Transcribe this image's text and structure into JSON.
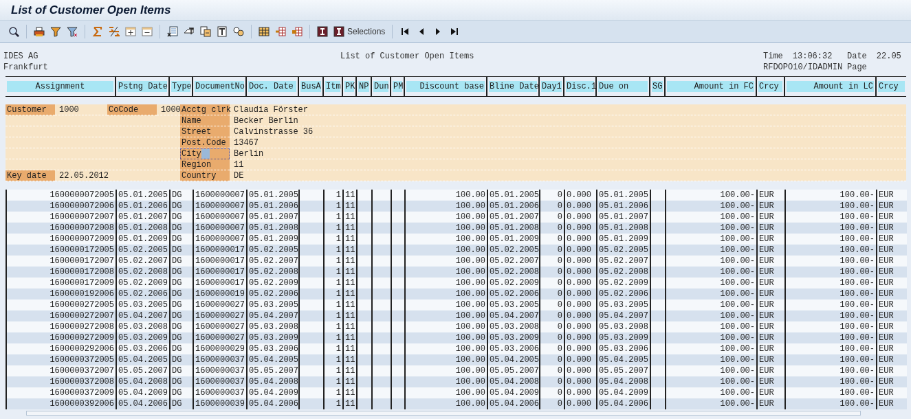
{
  "window": {
    "title": "List of Customer Open Items"
  },
  "toolbar": {
    "selections_label": "Selections"
  },
  "header": {
    "company": "IDES AG",
    "city": "Frankfurt",
    "report_title": "List of Customer Open Items",
    "time_label": "Time",
    "time": "13:06:32",
    "date_label": "Date",
    "date": "22.05",
    "program": "RFDOPO10/IDADMIN",
    "page_label": "Page"
  },
  "table": {
    "columns": [
      "Assignment",
      "Pstng Date",
      "Type",
      "DocumentNo",
      "Doc. Date",
      "BusA",
      "Itm",
      "PK",
      "NP",
      "Dun",
      "PM",
      "Discount base",
      "Bline Date",
      "Day1",
      "Disc.1",
      "Due on",
      "SG",
      "Amount in FC",
      "Crcy",
      "Amount in LC",
      "Crcy"
    ],
    "customer_block": {
      "customer_label": "Customer",
      "customer": "1000",
      "cocode_label": "CoCode",
      "cocode": "1000",
      "key_date_label": "Key date",
      "key_date": "22.05.2012",
      "details": [
        {
          "label": "Acctg clrk",
          "value": "Claudia Förster",
          "cursor": false
        },
        {
          "label": "Name",
          "value": "Becker Berlin",
          "cursor": false
        },
        {
          "label": "Street",
          "value": "Calvinstrasse 36",
          "cursor": false
        },
        {
          "label": "Post.Code",
          "value": "13467",
          "cursor": false
        },
        {
          "label": "City",
          "value": "Berlin",
          "cursor": true
        },
        {
          "label": "Region",
          "value": "11",
          "cursor": false
        },
        {
          "label": "Country",
          "value": "DE",
          "cursor": false
        }
      ]
    },
    "rows": [
      {
        "assignment": "1600000072005",
        "pstng_date": "05.01.2005",
        "type": "DG",
        "document_no": "1600000007",
        "doc_date": "05.01.2005",
        "itm": "1",
        "pk": "11",
        "discount_base": "100.00",
        "bline_date": "05.01.2005",
        "day1": "0",
        "disc_1": "0.000",
        "due_on": "05.01.2005",
        "amount_fc": "100.00-",
        "crcy_fc": "EUR",
        "amount_lc": "100.00-",
        "crcy_lc": "EUR"
      },
      {
        "assignment": "1600000072006",
        "pstng_date": "05.01.2006",
        "type": "DG",
        "document_no": "1600000007",
        "doc_date": "05.01.2006",
        "itm": "1",
        "pk": "11",
        "discount_base": "100.00",
        "bline_date": "05.01.2006",
        "day1": "0",
        "disc_1": "0.000",
        "due_on": "05.01.2006",
        "amount_fc": "100.00-",
        "crcy_fc": "EUR",
        "amount_lc": "100.00-",
        "crcy_lc": "EUR"
      },
      {
        "assignment": "1600000072007",
        "pstng_date": "05.01.2007",
        "type": "DG",
        "document_no": "1600000007",
        "doc_date": "05.01.2007",
        "itm": "1",
        "pk": "11",
        "discount_base": "100.00",
        "bline_date": "05.01.2007",
        "day1": "0",
        "disc_1": "0.000",
        "due_on": "05.01.2007",
        "amount_fc": "100.00-",
        "crcy_fc": "EUR",
        "amount_lc": "100.00-",
        "crcy_lc": "EUR"
      },
      {
        "assignment": "1600000072008",
        "pstng_date": "05.01.2008",
        "type": "DG",
        "document_no": "1600000007",
        "doc_date": "05.01.2008",
        "itm": "1",
        "pk": "11",
        "discount_base": "100.00",
        "bline_date": "05.01.2008",
        "day1": "0",
        "disc_1": "0.000",
        "due_on": "05.01.2008",
        "amount_fc": "100.00-",
        "crcy_fc": "EUR",
        "amount_lc": "100.00-",
        "crcy_lc": "EUR"
      },
      {
        "assignment": "1600000072009",
        "pstng_date": "05.01.2009",
        "type": "DG",
        "document_no": "1600000007",
        "doc_date": "05.01.2009",
        "itm": "1",
        "pk": "11",
        "discount_base": "100.00",
        "bline_date": "05.01.2009",
        "day1": "0",
        "disc_1": "0.000",
        "due_on": "05.01.2009",
        "amount_fc": "100.00-",
        "crcy_fc": "EUR",
        "amount_lc": "100.00-",
        "crcy_lc": "EUR"
      },
      {
        "assignment": "1600000172005",
        "pstng_date": "05.02.2005",
        "type": "DG",
        "document_no": "1600000017",
        "doc_date": "05.02.2005",
        "itm": "1",
        "pk": "11",
        "discount_base": "100.00",
        "bline_date": "05.02.2005",
        "day1": "0",
        "disc_1": "0.000",
        "due_on": "05.02.2005",
        "amount_fc": "100.00-",
        "crcy_fc": "EUR",
        "amount_lc": "100.00-",
        "crcy_lc": "EUR"
      },
      {
        "assignment": "1600000172007",
        "pstng_date": "05.02.2007",
        "type": "DG",
        "document_no": "1600000017",
        "doc_date": "05.02.2007",
        "itm": "1",
        "pk": "11",
        "discount_base": "100.00",
        "bline_date": "05.02.2007",
        "day1": "0",
        "disc_1": "0.000",
        "due_on": "05.02.2007",
        "amount_fc": "100.00-",
        "crcy_fc": "EUR",
        "amount_lc": "100.00-",
        "crcy_lc": "EUR"
      },
      {
        "assignment": "1600000172008",
        "pstng_date": "05.02.2008",
        "type": "DG",
        "document_no": "1600000017",
        "doc_date": "05.02.2008",
        "itm": "1",
        "pk": "11",
        "discount_base": "100.00",
        "bline_date": "05.02.2008",
        "day1": "0",
        "disc_1": "0.000",
        "due_on": "05.02.2008",
        "amount_fc": "100.00-",
        "crcy_fc": "EUR",
        "amount_lc": "100.00-",
        "crcy_lc": "EUR"
      },
      {
        "assignment": "1600000172009",
        "pstng_date": "05.02.2009",
        "type": "DG",
        "document_no": "1600000017",
        "doc_date": "05.02.2009",
        "itm": "1",
        "pk": "11",
        "discount_base": "100.00",
        "bline_date": "05.02.2009",
        "day1": "0",
        "disc_1": "0.000",
        "due_on": "05.02.2009",
        "amount_fc": "100.00-",
        "crcy_fc": "EUR",
        "amount_lc": "100.00-",
        "crcy_lc": "EUR"
      },
      {
        "assignment": "1600000192006",
        "pstng_date": "05.02.2006",
        "type": "DG",
        "document_no": "1600000019",
        "doc_date": "05.02.2006",
        "itm": "1",
        "pk": "11",
        "discount_base": "100.00",
        "bline_date": "05.02.2006",
        "day1": "0",
        "disc_1": "0.000",
        "due_on": "05.02.2006",
        "amount_fc": "100.00-",
        "crcy_fc": "EUR",
        "amount_lc": "100.00-",
        "crcy_lc": "EUR"
      },
      {
        "assignment": "1600000272005",
        "pstng_date": "05.03.2005",
        "type": "DG",
        "document_no": "1600000027",
        "doc_date": "05.03.2005",
        "itm": "1",
        "pk": "11",
        "discount_base": "100.00",
        "bline_date": "05.03.2005",
        "day1": "0",
        "disc_1": "0.000",
        "due_on": "05.03.2005",
        "amount_fc": "100.00-",
        "crcy_fc": "EUR",
        "amount_lc": "100.00-",
        "crcy_lc": "EUR"
      },
      {
        "assignment": "1600000272007",
        "pstng_date": "05.04.2007",
        "type": "DG",
        "document_no": "1600000027",
        "doc_date": "05.04.2007",
        "itm": "1",
        "pk": "11",
        "discount_base": "100.00",
        "bline_date": "05.04.2007",
        "day1": "0",
        "disc_1": "0.000",
        "due_on": "05.04.2007",
        "amount_fc": "100.00-",
        "crcy_fc": "EUR",
        "amount_lc": "100.00-",
        "crcy_lc": "EUR"
      },
      {
        "assignment": "1600000272008",
        "pstng_date": "05.03.2008",
        "type": "DG",
        "document_no": "1600000027",
        "doc_date": "05.03.2008",
        "itm": "1",
        "pk": "11",
        "discount_base": "100.00",
        "bline_date": "05.03.2008",
        "day1": "0",
        "disc_1": "0.000",
        "due_on": "05.03.2008",
        "amount_fc": "100.00-",
        "crcy_fc": "EUR",
        "amount_lc": "100.00-",
        "crcy_lc": "EUR"
      },
      {
        "assignment": "1600000272009",
        "pstng_date": "05.03.2009",
        "type": "DG",
        "document_no": "1600000027",
        "doc_date": "05.03.2009",
        "itm": "1",
        "pk": "11",
        "discount_base": "100.00",
        "bline_date": "05.03.2009",
        "day1": "0",
        "disc_1": "0.000",
        "due_on": "05.03.2009",
        "amount_fc": "100.00-",
        "crcy_fc": "EUR",
        "amount_lc": "100.00-",
        "crcy_lc": "EUR"
      },
      {
        "assignment": "1600000292006",
        "pstng_date": "05.03.2006",
        "type": "DG",
        "document_no": "1600000029",
        "doc_date": "05.03.2006",
        "itm": "1",
        "pk": "11",
        "discount_base": "100.00",
        "bline_date": "05.03.2006",
        "day1": "0",
        "disc_1": "0.000",
        "due_on": "05.03.2006",
        "amount_fc": "100.00-",
        "crcy_fc": "EUR",
        "amount_lc": "100.00-",
        "crcy_lc": "EUR"
      },
      {
        "assignment": "1600000372005",
        "pstng_date": "05.04.2005",
        "type": "DG",
        "document_no": "1600000037",
        "doc_date": "05.04.2005",
        "itm": "1",
        "pk": "11",
        "discount_base": "100.00",
        "bline_date": "05.04.2005",
        "day1": "0",
        "disc_1": "0.000",
        "due_on": "05.04.2005",
        "amount_fc": "100.00-",
        "crcy_fc": "EUR",
        "amount_lc": "100.00-",
        "crcy_lc": "EUR"
      },
      {
        "assignment": "1600000372007",
        "pstng_date": "05.05.2007",
        "type": "DG",
        "document_no": "1600000037",
        "doc_date": "05.05.2007",
        "itm": "1",
        "pk": "11",
        "discount_base": "100.00",
        "bline_date": "05.05.2007",
        "day1": "0",
        "disc_1": "0.000",
        "due_on": "05.05.2007",
        "amount_fc": "100.00-",
        "crcy_fc": "EUR",
        "amount_lc": "100.00-",
        "crcy_lc": "EUR"
      },
      {
        "assignment": "1600000372008",
        "pstng_date": "05.04.2008",
        "type": "DG",
        "document_no": "1600000037",
        "doc_date": "05.04.2008",
        "itm": "1",
        "pk": "11",
        "discount_base": "100.00",
        "bline_date": "05.04.2008",
        "day1": "0",
        "disc_1": "0.000",
        "due_on": "05.04.2008",
        "amount_fc": "100.00-",
        "crcy_fc": "EUR",
        "amount_lc": "100.00-",
        "crcy_lc": "EUR"
      },
      {
        "assignment": "1600000372009",
        "pstng_date": "05.04.2009",
        "type": "DG",
        "document_no": "1600000037",
        "doc_date": "05.04.2009",
        "itm": "1",
        "pk": "11",
        "discount_base": "100.00",
        "bline_date": "05.04.2009",
        "day1": "0",
        "disc_1": "0.000",
        "due_on": "05.04.2009",
        "amount_fc": "100.00-",
        "crcy_fc": "EUR",
        "amount_lc": "100.00-",
        "crcy_lc": "EUR"
      },
      {
        "assignment": "1600000392006",
        "pstng_date": "05.04.2006",
        "type": "DG",
        "document_no": "1600000039",
        "doc_date": "05.04.2006",
        "itm": "1",
        "pk": "11",
        "discount_base": "100.00",
        "bline_date": "05.04.2006",
        "day1": "0",
        "disc_1": "0.000",
        "due_on": "05.04.2006",
        "amount_fc": "100.00-",
        "crcy_fc": "EUR",
        "amount_lc": "100.00-",
        "crcy_lc": "EUR"
      }
    ]
  }
}
